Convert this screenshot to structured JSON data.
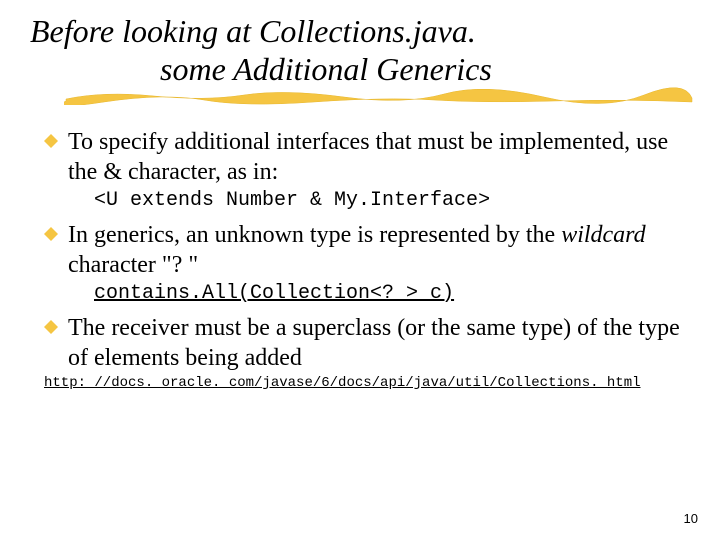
{
  "title": {
    "line1": "Before looking at Collections.java.",
    "line2": "some Additional Generics"
  },
  "bullets": {
    "b1_pre": "To specify additional interfaces that must be implemented, use the & character, as in:",
    "code1": "<U extends Number & My.Interface>",
    "b2_pre": "In generics, an unknown type is represented by the ",
    "b2_italic": "wildcard",
    "b2_post": " character \"? \"",
    "code2": "contains.All(Collection<? > c)",
    "b3": "The receiver must be a superclass (or the same type) of the type of elements being added"
  },
  "ref": "http: //docs. oracle. com/javase/6/docs/api/java/util/Collections. html",
  "page": "10"
}
